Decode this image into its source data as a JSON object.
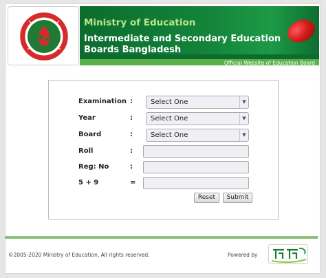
{
  "header": {
    "ministry": "Ministry of Education",
    "title": "Intermediate and Secondary Education Boards Bangladesh",
    "subtitle": "Official Website of Education Board"
  },
  "form": {
    "fields": [
      {
        "label": "Examination",
        "colon": ":",
        "type": "select",
        "value": "Select One"
      },
      {
        "label": "Year",
        "colon": ":",
        "type": "select",
        "value": "Select One"
      },
      {
        "label": "Board",
        "colon": ":",
        "type": "select",
        "value": "Select One"
      },
      {
        "label": "Roll",
        "colon": ":",
        "type": "input",
        "value": ""
      },
      {
        "label": "Reg: No",
        "colon": ":",
        "type": "input",
        "value": ""
      },
      {
        "label": "5 + 9",
        "colon": "=",
        "type": "input",
        "value": ""
      }
    ],
    "reset_label": "Reset",
    "submit_label": "Submit"
  },
  "footer": {
    "copyright": "©2005-2020 Ministry of Education, All rights reserved.",
    "powered_by": "Powered by"
  },
  "colors": {
    "header_green": "#0d6b2f",
    "ministry_text": "#b9e68b",
    "subbar_green": "#5ab14a",
    "footer_line": "#8dc27b",
    "emblem_red": "#d62b2b",
    "emblem_green": "#1f7a34"
  },
  "icons": {
    "logo": "bangladesh-government-emblem",
    "banner_graphic": "red-ball-graphic",
    "sponsor": "teletalk-logo",
    "dropdown": "chevron-down-icon"
  }
}
